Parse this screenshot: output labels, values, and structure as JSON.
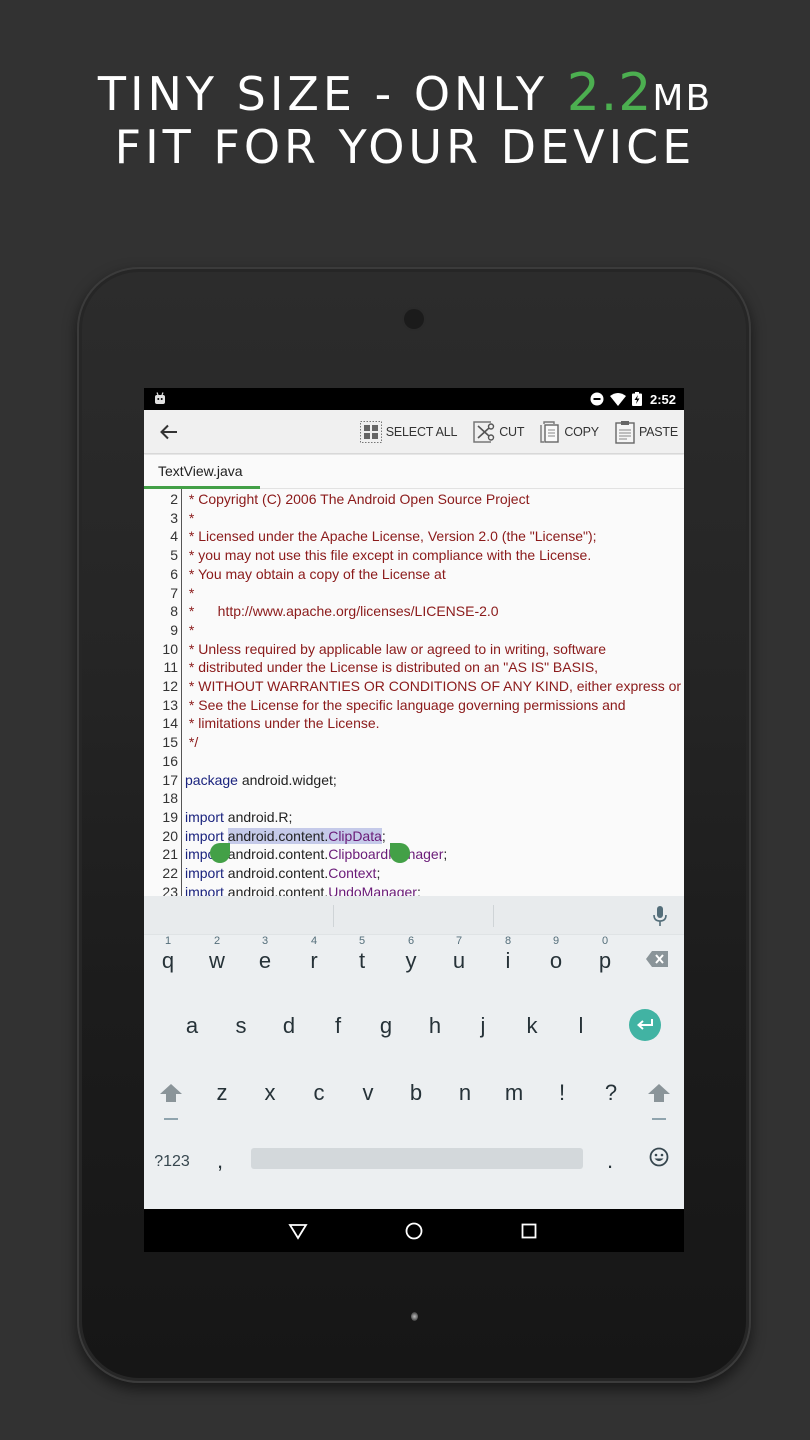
{
  "headline": {
    "line1_prefix": "TINY SIZE - ONLY ",
    "line1_accent": "2.2",
    "line1_unit": "MB",
    "line2": "FIT FOR YOUR DEVICE",
    "accent_color": "#4caf50"
  },
  "statusbar": {
    "notification_icon": "android-debug-icon",
    "icons": [
      "do-not-disturb-icon",
      "wifi-icon",
      "battery-charging-icon"
    ],
    "time": "2:52"
  },
  "actionbar": {
    "back_icon": "arrow-back-icon",
    "actions": [
      {
        "label": "SELECT ALL",
        "icon": "select-all-icon"
      },
      {
        "label": "CUT",
        "icon": "cut-icon"
      },
      {
        "label": "COPY",
        "icon": "copy-icon"
      },
      {
        "label": "PASTE",
        "icon": "paste-icon"
      }
    ]
  },
  "tabs": [
    {
      "label": "TextView.java",
      "active": true
    }
  ],
  "editor": {
    "lines": [
      {
        "n": "2",
        "parts": [
          {
            "t": " * Copyright (C) 2006 The Android Open Source Project",
            "c": "comment"
          }
        ]
      },
      {
        "n": "3",
        "parts": [
          {
            "t": " *",
            "c": "comment"
          }
        ]
      },
      {
        "n": "4",
        "parts": [
          {
            "t": " * Licensed under the Apache License, Version 2.0 (the \"License\");",
            "c": "comment"
          }
        ]
      },
      {
        "n": "5",
        "parts": [
          {
            "t": " * you may not use this file except in compliance with the License.",
            "c": "comment"
          }
        ]
      },
      {
        "n": "6",
        "parts": [
          {
            "t": " * You may obtain a copy of the License at",
            "c": "comment"
          }
        ]
      },
      {
        "n": "7",
        "parts": [
          {
            "t": " *",
            "c": "comment"
          }
        ]
      },
      {
        "n": "8",
        "parts": [
          {
            "t": " *      http://www.apache.org/licenses/LICENSE-2.0",
            "c": "comment"
          }
        ]
      },
      {
        "n": "9",
        "parts": [
          {
            "t": " *",
            "c": "comment"
          }
        ]
      },
      {
        "n": "10",
        "parts": [
          {
            "t": " * Unless required by applicable law or agreed to in writing, software",
            "c": "comment"
          }
        ]
      },
      {
        "n": "11",
        "parts": [
          {
            "t": " * distributed under the License is distributed on an \"AS IS\" BASIS,",
            "c": "comment"
          }
        ]
      },
      {
        "n": "12",
        "parts": [
          {
            "t": " * WITHOUT WARRANTIES OR CONDITIONS OF ANY KIND, either express or implied.",
            "c": "comment"
          }
        ]
      },
      {
        "n": "13",
        "parts": [
          {
            "t": " * See the License for the specific language governing permissions and",
            "c": "comment"
          }
        ]
      },
      {
        "n": "14",
        "parts": [
          {
            "t": " * limitations under the License.",
            "c": "comment"
          }
        ]
      },
      {
        "n": "15",
        "parts": [
          {
            "t": " */",
            "c": "comment"
          }
        ]
      },
      {
        "n": "16",
        "parts": []
      },
      {
        "n": "17",
        "parts": [
          {
            "t": "package",
            "c": "kw"
          },
          {
            "t": " android.widget;",
            "c": "plain"
          }
        ]
      },
      {
        "n": "18",
        "parts": []
      },
      {
        "n": "19",
        "parts": [
          {
            "t": "import",
            "c": "kw"
          },
          {
            "t": " android.R;",
            "c": "plain"
          }
        ]
      },
      {
        "n": "20",
        "parts": [
          {
            "t": "import",
            "c": "kw"
          },
          {
            "t": " ",
            "c": "plain"
          },
          {
            "t": "android.content.",
            "c": "plain",
            "sel": true
          },
          {
            "t": "ClipData",
            "c": "cls",
            "sel": true
          },
          {
            "t": ";",
            "c": "plain"
          }
        ]
      },
      {
        "n": "21",
        "parts": [
          {
            "t": "import",
            "c": "kw"
          },
          {
            "t": " android.content.",
            "c": "plain"
          },
          {
            "t": "ClipboardManager",
            "c": "cls"
          },
          {
            "t": ";",
            "c": "plain"
          }
        ]
      },
      {
        "n": "22",
        "parts": [
          {
            "t": "import",
            "c": "kw"
          },
          {
            "t": " android.content.",
            "c": "plain"
          },
          {
            "t": "Context",
            "c": "cls"
          },
          {
            "t": ";",
            "c": "plain"
          }
        ]
      },
      {
        "n": "23",
        "parts": [
          {
            "t": "import",
            "c": "kw"
          },
          {
            "t": " android.content.",
            "c": "plain"
          },
          {
            "t": "UndoManager",
            "c": "cls"
          },
          {
            "t": ";",
            "c": "plain"
          }
        ]
      }
    ],
    "selection": "android.content.ClipData",
    "selection_handle_color": "#43a047"
  },
  "keyboard": {
    "suggestions": [
      "",
      "",
      ""
    ],
    "mic_icon": "microphone-icon",
    "row1": [
      {
        "k": "q",
        "h": "1"
      },
      {
        "k": "w",
        "h": "2"
      },
      {
        "k": "e",
        "h": "3"
      },
      {
        "k": "r",
        "h": "4"
      },
      {
        "k": "t",
        "h": "5"
      },
      {
        "k": "y",
        "h": "6"
      },
      {
        "k": "u",
        "h": "7"
      },
      {
        "k": "i",
        "h": "8"
      },
      {
        "k": "o",
        "h": "9"
      },
      {
        "k": "p",
        "h": "0"
      }
    ],
    "row2": [
      "a",
      "s",
      "d",
      "f",
      "g",
      "h",
      "j",
      "k",
      "l"
    ],
    "row3": [
      "z",
      "x",
      "c",
      "v",
      "b",
      "n",
      "m",
      "!",
      "?"
    ],
    "symbols_label": "?123",
    "comma": ",",
    "period": ".",
    "enter_color": "#41b3a3"
  },
  "navbar": {
    "buttons": [
      "back-triangle-icon",
      "home-circle-icon",
      "recents-square-icon"
    ]
  }
}
